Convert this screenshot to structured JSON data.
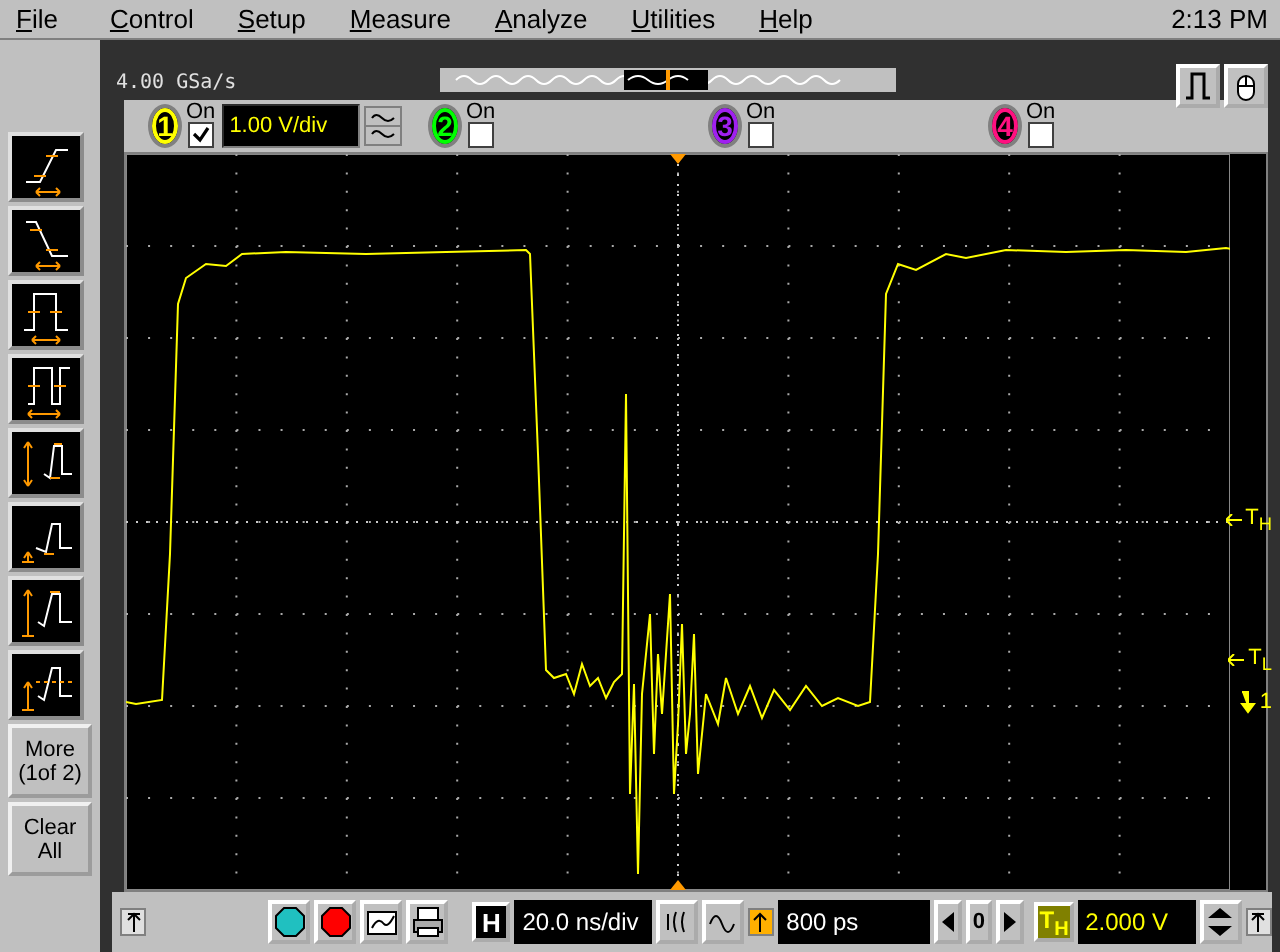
{
  "menu": [
    {
      "label": "File"
    },
    {
      "label": "Control"
    },
    {
      "label": "Setup"
    },
    {
      "label": "Measure"
    },
    {
      "label": "Analyze"
    },
    {
      "label": "Utilities"
    },
    {
      "label": "Help"
    }
  ],
  "clock": "2:13 PM",
  "sample_rate": "4.00 GSa/s",
  "channels": [
    {
      "number": "1",
      "label": "On",
      "checked": true,
      "scale": "1.00 V/div",
      "color": "#ffff00"
    },
    {
      "number": "2",
      "label": "On",
      "checked": false,
      "color": "#00ff00"
    },
    {
      "number": "3",
      "label": "On",
      "checked": false,
      "color": "#a020f0"
    },
    {
      "number": "4",
      "label": "On",
      "checked": false,
      "color": "#ff1080"
    }
  ],
  "measure_buttons": [
    {
      "kind": "rise"
    },
    {
      "kind": "fall"
    },
    {
      "kind": "width"
    },
    {
      "kind": "period"
    },
    {
      "kind": "vpp"
    },
    {
      "kind": "vmin"
    },
    {
      "kind": "vmax"
    },
    {
      "kind": "vavg"
    }
  ],
  "sidebar_buttons": [
    {
      "label": "More (1of 2)"
    },
    {
      "label": "Clear All"
    }
  ],
  "markers": [
    {
      "label": "T$_{H}$"
    },
    {
      "label": "T$_{L}$"
    }
  ],
  "trigger_marker": "1",
  "bottom": {
    "horizontal_label": "H",
    "timebase": "20.0 ns/div",
    "delay": "800 ps",
    "delay_zero": "0",
    "trigger_label": "T$_{H}$",
    "trigger_level": "2.000 V"
  }
}
